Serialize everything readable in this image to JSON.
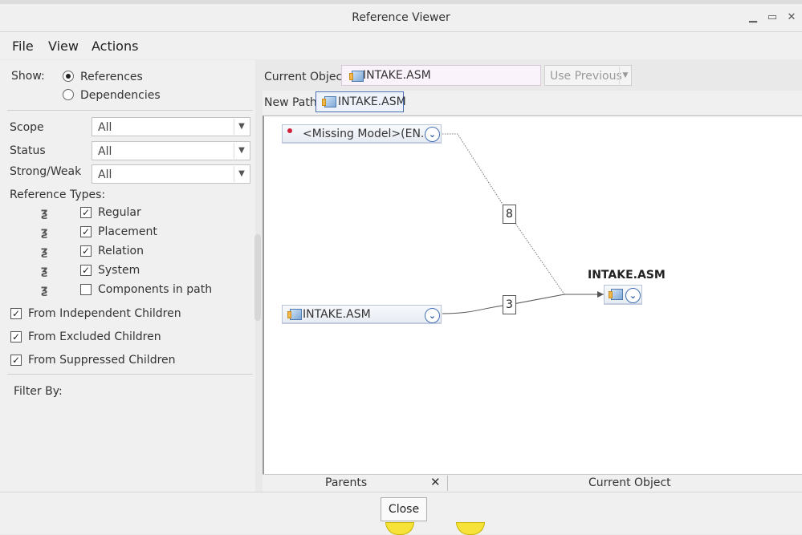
{
  "window": {
    "title": "Reference Viewer"
  },
  "menu": [
    "File",
    "View",
    "Actions"
  ],
  "show": {
    "label": "Show:",
    "options": [
      {
        "label": "References",
        "selected": true
      },
      {
        "label": "Dependencies",
        "selected": false
      }
    ]
  },
  "filters": [
    {
      "label": "Scope",
      "value": "All"
    },
    {
      "label": "Status",
      "value": "All"
    },
    {
      "label": "Strong/Weak",
      "value": "All"
    }
  ],
  "reference_types": {
    "label": "Reference Types:",
    "items": [
      {
        "label": "Regular",
        "checked": true
      },
      {
        "label": "Placement",
        "checked": true
      },
      {
        "label": "Relation",
        "checked": true
      },
      {
        "label": "System",
        "checked": true
      },
      {
        "label": "Components in path",
        "checked": false
      }
    ]
  },
  "options": [
    {
      "label": "From Independent Children",
      "checked": true
    },
    {
      "label": "From Excluded Children",
      "checked": true
    },
    {
      "label": "From Suppressed Children",
      "checked": true
    }
  ],
  "filter_by": {
    "label": "Filter By:"
  },
  "toolbar": {
    "current_object_label": "Current Object:",
    "current_object_value": "INTAKE.ASM",
    "use_previous_label": "Use Previous",
    "new_path_label": "New Path:",
    "new_path_value": "INTAKE.ASM"
  },
  "graph": {
    "missing_node_label": "<Missing Model>(EN...",
    "child_node_label": "INTAKE.ASM",
    "target_title": "INTAKE.ASM",
    "edge_count_missing": "8",
    "edge_count_child": "3"
  },
  "bottom_tabs": {
    "parents": "Parents",
    "current_object": "Current Object"
  },
  "footer": {
    "close_label": "Close"
  },
  "colors": {
    "accent": "#3f6fb6",
    "missing_dot": "#d0203a",
    "current_object_field_bg": "#fbf3fb"
  }
}
